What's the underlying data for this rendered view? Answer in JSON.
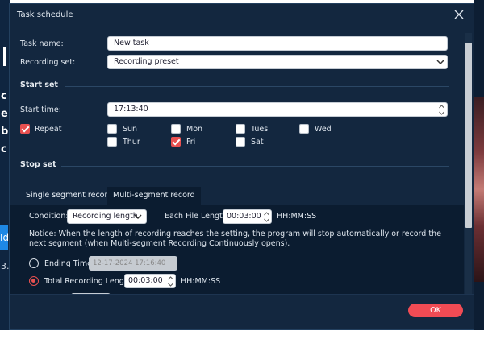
{
  "dialog": {
    "title": "Task schedule",
    "close_icon": "close-icon"
  },
  "task_name": {
    "label": "Task name:",
    "value": "New task"
  },
  "recording_set": {
    "label": "Recording set:",
    "value": "Recording preset"
  },
  "start_set": {
    "heading": "Start set",
    "start_time_label": "Start time:",
    "start_time_value": "17:13:40",
    "repeat_label": "Repeat",
    "repeat_checked": true,
    "days": [
      {
        "label": "Sun",
        "checked": false
      },
      {
        "label": "Mon",
        "checked": false
      },
      {
        "label": "Tues",
        "checked": false
      },
      {
        "label": "Wed",
        "checked": false
      },
      {
        "label": "Thur",
        "checked": false
      },
      {
        "label": "Fri",
        "checked": true
      },
      {
        "label": "Sat",
        "checked": false
      }
    ]
  },
  "stop_set": {
    "heading": "Stop set",
    "tabs": [
      {
        "label": "Single segment record",
        "active": false
      },
      {
        "label": "Multi-segment record",
        "active": true
      }
    ],
    "condition_label": "Condition:",
    "condition_value": "Recording length",
    "file_length_label": "Each File Length:",
    "file_length_value": "00:03:00",
    "file_length_unit": "HH:MM:SS",
    "notice": "Notice: When the length of recording reaches the setting, the program will stop automatically or record the next segment (when Multi-segment Recording Continuously opens).",
    "ending_time_label": "Ending Time:",
    "ending_time_value": "12-17-2024 17:16:40",
    "total_length_label": "Total Recording Length:",
    "total_length_value": "00:03:00",
    "total_length_unit": "HH:MM:SS",
    "selected_option": "total_recording_length"
  },
  "footer": {
    "ok_label": "OK"
  },
  "background": {
    "left_glyphs": [
      "c",
      "e",
      "b",
      "c"
    ],
    "left_button_text": "Id",
    "left_number": "3."
  },
  "colors": {
    "dialog_bg": "#13273f",
    "panel_bg": "#0b1c30",
    "accent": "#e85050",
    "ok_button": "#f04b54"
  }
}
